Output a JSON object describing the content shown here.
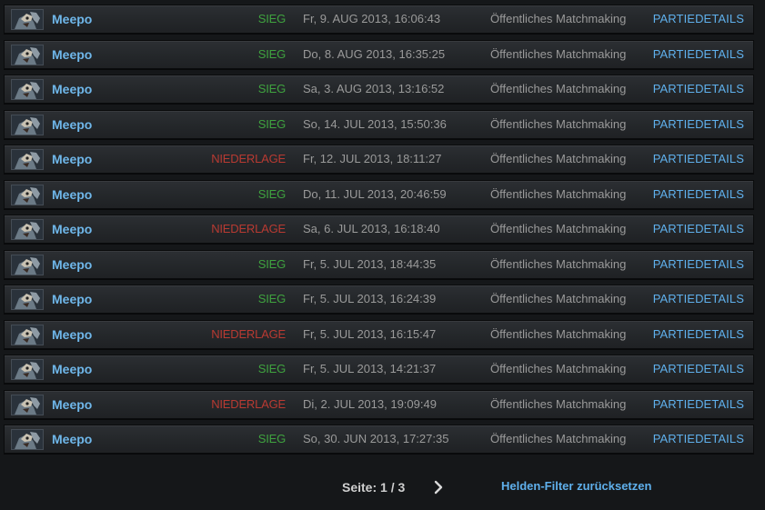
{
  "hero_name": "Meepo",
  "colors": {
    "win": "#3fa33f",
    "loss": "#b83a32",
    "link": "#5fb0ec",
    "background": "#151719"
  },
  "matches": [
    {
      "hero": "Meepo",
      "result": "SIEG",
      "outcome": "win",
      "date": "Fr, 9. AUG 2013, 16:06:43",
      "mode": "Öffentliches Matchmaking",
      "details": "PARTIEDETAILS"
    },
    {
      "hero": "Meepo",
      "result": "SIEG",
      "outcome": "win",
      "date": "Do, 8. AUG 2013, 16:35:25",
      "mode": "Öffentliches Matchmaking",
      "details": "PARTIEDETAILS"
    },
    {
      "hero": "Meepo",
      "result": "SIEG",
      "outcome": "win",
      "date": "Sa, 3. AUG 2013, 13:16:52",
      "mode": "Öffentliches Matchmaking",
      "details": "PARTIEDETAILS"
    },
    {
      "hero": "Meepo",
      "result": "SIEG",
      "outcome": "win",
      "date": "So, 14. JUL 2013, 15:50:36",
      "mode": "Öffentliches Matchmaking",
      "details": "PARTIEDETAILS"
    },
    {
      "hero": "Meepo",
      "result": "NIEDERLAGE",
      "outcome": "loss",
      "date": "Fr, 12. JUL 2013, 18:11:27",
      "mode": "Öffentliches Matchmaking",
      "details": "PARTIEDETAILS"
    },
    {
      "hero": "Meepo",
      "result": "SIEG",
      "outcome": "win",
      "date": "Do, 11. JUL 2013, 20:46:59",
      "mode": "Öffentliches Matchmaking",
      "details": "PARTIEDETAILS"
    },
    {
      "hero": "Meepo",
      "result": "NIEDERLAGE",
      "outcome": "loss",
      "date": "Sa, 6. JUL 2013, 16:18:40",
      "mode": "Öffentliches Matchmaking",
      "details": "PARTIEDETAILS"
    },
    {
      "hero": "Meepo",
      "result": "SIEG",
      "outcome": "win",
      "date": "Fr, 5. JUL 2013, 18:44:35",
      "mode": "Öffentliches Matchmaking",
      "details": "PARTIEDETAILS"
    },
    {
      "hero": "Meepo",
      "result": "SIEG",
      "outcome": "win",
      "date": "Fr, 5. JUL 2013, 16:24:39",
      "mode": "Öffentliches Matchmaking",
      "details": "PARTIEDETAILS"
    },
    {
      "hero": "Meepo",
      "result": "NIEDERLAGE",
      "outcome": "loss",
      "date": "Fr, 5. JUL 2013, 16:15:47",
      "mode": "Öffentliches Matchmaking",
      "details": "PARTIEDETAILS"
    },
    {
      "hero": "Meepo",
      "result": "SIEG",
      "outcome": "win",
      "date": "Fr, 5. JUL 2013, 14:21:37",
      "mode": "Öffentliches Matchmaking",
      "details": "PARTIEDETAILS"
    },
    {
      "hero": "Meepo",
      "result": "NIEDERLAGE",
      "outcome": "loss",
      "date": "Di, 2. JUL 2013, 19:09:49",
      "mode": "Öffentliches Matchmaking",
      "details": "PARTIEDETAILS"
    },
    {
      "hero": "Meepo",
      "result": "SIEG",
      "outcome": "win",
      "date": "So, 30. JUN 2013, 17:27:35",
      "mode": "Öffentliches Matchmaking",
      "details": "PARTIEDETAILS"
    }
  ],
  "pagination": {
    "label": "Seite: 1 / 3",
    "next_icon": "chevron-right-icon"
  },
  "reset_filter_label": "Helden-Filter zurücksetzen"
}
